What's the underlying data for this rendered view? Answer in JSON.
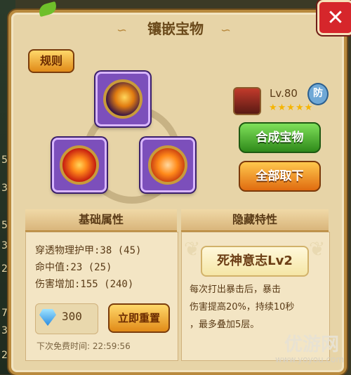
{
  "window": {
    "title": "镶嵌宝物"
  },
  "buttons": {
    "rules": "规则",
    "synthesize": "合成宝物",
    "remove_all": "全部取下",
    "reset_now": "立即重置",
    "close": "✕"
  },
  "character": {
    "level": "Lv.80",
    "defense_badge": "防",
    "stars": "★★★★★"
  },
  "sections": {
    "basic": "基础属性",
    "hidden": "隐藏特性"
  },
  "stats": [
    "穿透物理护甲:38 (45)",
    "命中值:23 (25)",
    "伤害增加:155 (240)"
  ],
  "hidden_trait": {
    "name": "死神意志Lv2",
    "description": [
      "每次打出暴击后，暴击",
      "伤害提高20%，持续10秒",
      "，最多叠加5层。"
    ]
  },
  "currency": {
    "diamonds": "300"
  },
  "timer": "下次免费时间: 22:59:56",
  "watermark": {
    "brand": "优游网",
    "url": "www.yoyou.com"
  },
  "colors": {
    "accent_gold": "#b98a3e",
    "socket_purple": "#7c4fbb",
    "green_button": "#2f8a1a",
    "orange_button": "#e06b10"
  },
  "gems": [
    "claw-slash-gem-icon",
    "triangle-sigil-gem-icon",
    "paw-print-gem-icon"
  ],
  "background": {
    "side_numbers": [
      "5",
      "3",
      "5",
      "3",
      "2",
      "7",
      "3",
      "2"
    ]
  }
}
